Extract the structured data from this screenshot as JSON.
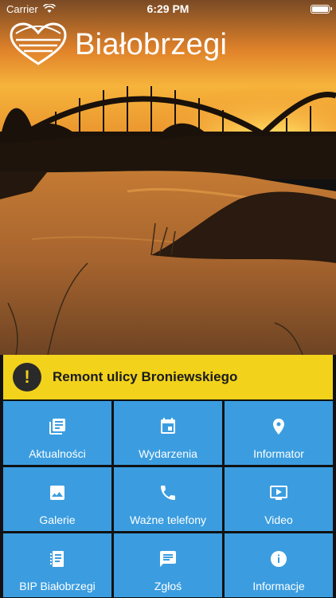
{
  "status_bar": {
    "carrier": "Carrier",
    "time": "6:29 PM",
    "battery_level": 1.0
  },
  "brand": {
    "name": "Białobrzegi"
  },
  "alert": {
    "icon": "exclamation-icon",
    "symbol": "!",
    "text": "Remont ulicy Broniewskiego",
    "color": "#f2d21b"
  },
  "tile_color": "#3b9de0",
  "tiles": [
    {
      "label": "Aktualności",
      "icon": "news-icon"
    },
    {
      "label": "Wydarzenia",
      "icon": "calendar-icon"
    },
    {
      "label": "Informator",
      "icon": "location-pin-icon"
    },
    {
      "label": "Galerie",
      "icon": "image-gallery-icon"
    },
    {
      "label": "Ważne telefony",
      "icon": "phone-icon"
    },
    {
      "label": "Video",
      "icon": "video-icon"
    },
    {
      "label": "BIP Białobrzegi",
      "icon": "notebook-icon"
    },
    {
      "label": "Zgłoś",
      "icon": "comment-icon"
    },
    {
      "label": "Informacje",
      "icon": "info-icon"
    }
  ]
}
